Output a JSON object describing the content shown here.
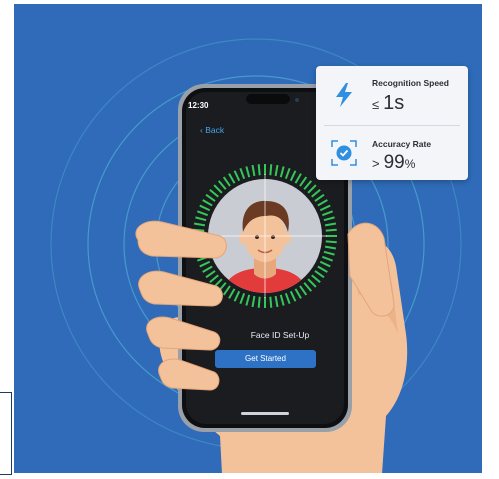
{
  "phone": {
    "status_time": "12:30",
    "back_label": "Back",
    "screen_title": "Face ID Set-Up",
    "cta_label": "Get Started"
  },
  "metrics": [
    {
      "label": "Recognition Speed",
      "operator": "≤",
      "value": "1s",
      "icon": "lightning-bolt-icon"
    },
    {
      "label": "Accuracy Rate",
      "operator": ">",
      "value": "99",
      "unit": "%",
      "icon": "check-badge-icon"
    }
  ],
  "colors": {
    "background": "#2f6bb8",
    "ring": "#5bc0de",
    "scan_ticks": "#35c759",
    "button": "#2d72c4",
    "shirt": "#e23b3b",
    "skin": "#f4c29a"
  }
}
